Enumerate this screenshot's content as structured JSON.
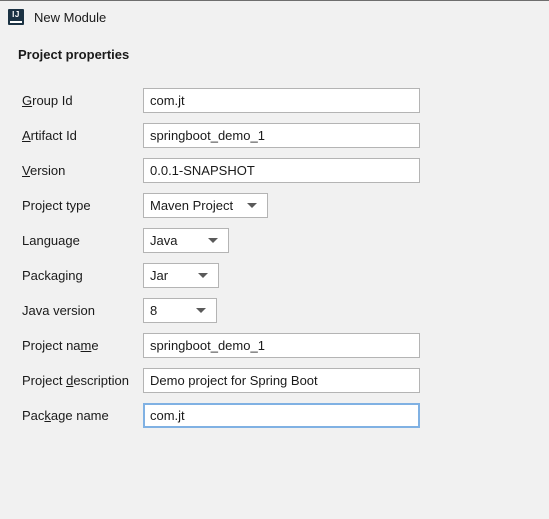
{
  "window": {
    "title": "New Module",
    "icon": "intellij-idea-icon"
  },
  "section": {
    "title": "Project properties"
  },
  "colors": {
    "background": "#f1f1f1",
    "field_background": "#ffffff",
    "field_border": "#b4b4b4",
    "focus_border": "#80b1e3",
    "text": "#1a1a1a",
    "icon_background": "#1b3243"
  },
  "form": {
    "fields": [
      {
        "label_before": "",
        "label_mnemonic": "G",
        "label_after": "roup Id",
        "label_full": "Group Id",
        "type": "text",
        "value": "com.jt",
        "placeholder": "",
        "focused": false
      },
      {
        "label_before": "",
        "label_mnemonic": "A",
        "label_after": "rtifact Id",
        "label_full": "Artifact Id",
        "type": "text",
        "value": "springboot_demo_1",
        "placeholder": "",
        "focused": false
      },
      {
        "label_before": "",
        "label_mnemonic": "V",
        "label_after": "ersion",
        "label_full": "Version",
        "type": "text",
        "value": "0.0.1-SNAPSHOT",
        "placeholder": "",
        "focused": false
      },
      {
        "label_before": "Project type",
        "label_mnemonic": "",
        "label_after": "",
        "label_full": "Project type",
        "type": "combo",
        "value": "Maven Project",
        "width_class": "w-maven",
        "focused": false
      },
      {
        "label_before": "Language",
        "label_mnemonic": "",
        "label_after": "",
        "label_full": "Language",
        "type": "combo",
        "value": "Java",
        "width_class": "w-lang",
        "focused": false
      },
      {
        "label_before": "Packaging",
        "label_mnemonic": "",
        "label_after": "",
        "label_full": "Packaging",
        "type": "combo",
        "value": "Jar",
        "width_class": "w-pkg",
        "focused": false
      },
      {
        "label_before": "Java version",
        "label_mnemonic": "",
        "label_after": "",
        "label_full": "Java version",
        "type": "combo",
        "value": "8",
        "width_class": "w-jdk",
        "focused": false
      },
      {
        "label_before": "Project na",
        "label_mnemonic": "m",
        "label_after": "e",
        "label_full": "Project name",
        "type": "text",
        "value": "springboot_demo_1",
        "placeholder": "",
        "focused": false
      },
      {
        "label_before": "Project ",
        "label_mnemonic": "d",
        "label_after": "escription",
        "label_full": "Project description",
        "type": "text",
        "value": "Demo project for Spring Boot",
        "placeholder": "",
        "focused": false
      },
      {
        "label_before": "Pac",
        "label_mnemonic": "k",
        "label_after": "age name",
        "label_full": "Package name",
        "type": "text",
        "value": "com.jt",
        "placeholder": "",
        "focused": true
      }
    ]
  }
}
